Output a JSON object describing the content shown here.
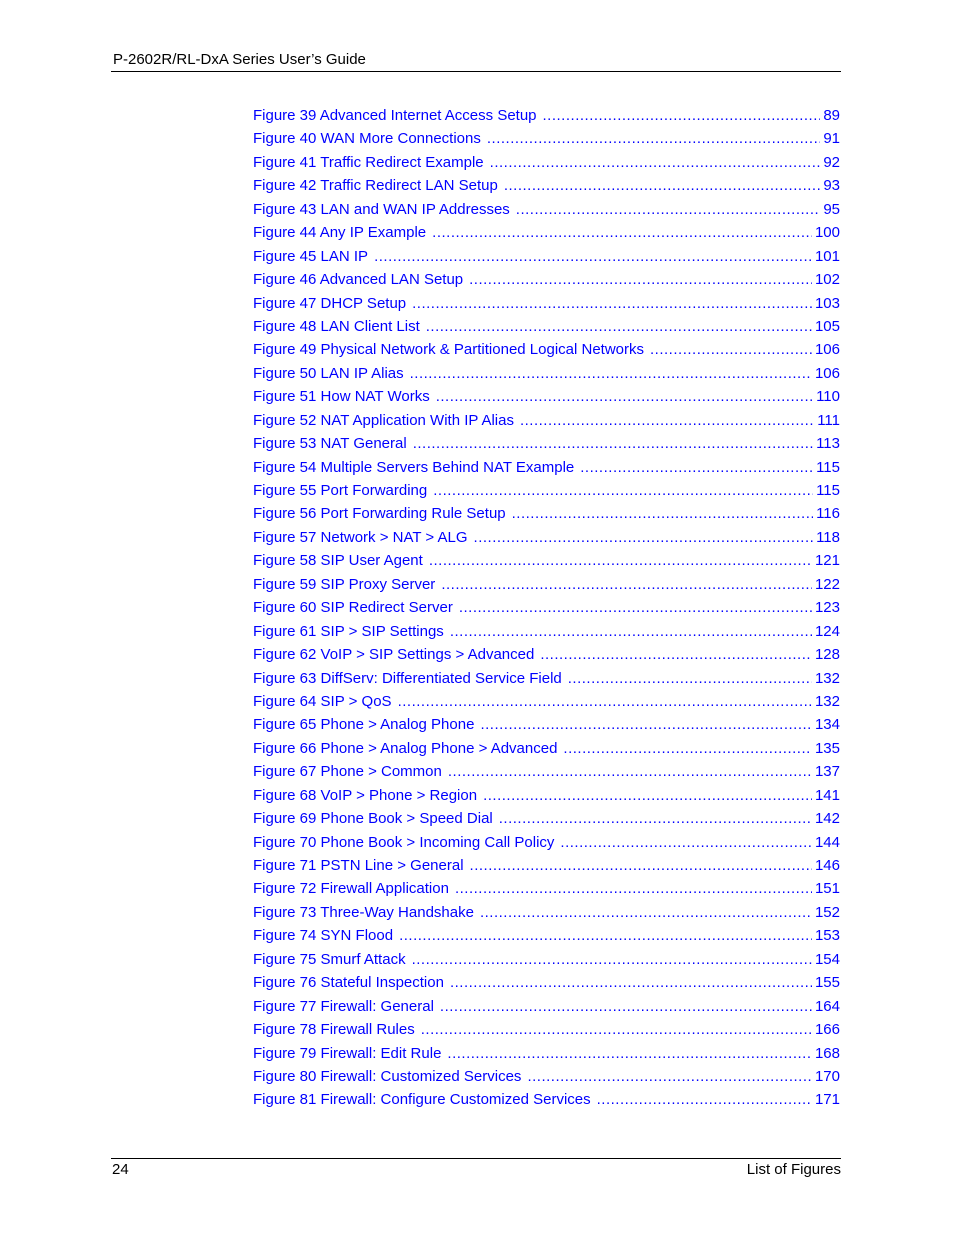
{
  "header": {
    "title": "P-2602R/RL-DxA Series User’s Guide"
  },
  "toc": {
    "entries": [
      {
        "title": "Figure 39 Advanced Internet Access Setup",
        "page": "89"
      },
      {
        "title": "Figure 40 WAN More Connections",
        "page": "91"
      },
      {
        "title": "Figure 41 Traffic Redirect Example",
        "page": "92"
      },
      {
        "title": "Figure 42 Traffic Redirect LAN Setup",
        "page": "93"
      },
      {
        "title": "Figure 43 LAN and WAN IP Addresses",
        "page": "95"
      },
      {
        "title": "Figure 44 Any IP Example",
        "page": "100"
      },
      {
        "title": "Figure 45 LAN IP",
        "page": "101"
      },
      {
        "title": "Figure 46 Advanced LAN Setup",
        "page": "102"
      },
      {
        "title": "Figure 47 DHCP Setup",
        "page": "103"
      },
      {
        "title": "Figure 48 LAN Client List",
        "page": "105"
      },
      {
        "title": "Figure 49 Physical Network & Partitioned Logical Networks",
        "page": "106"
      },
      {
        "title": "Figure 50 LAN IP Alias",
        "page": "106"
      },
      {
        "title": "Figure 51 How NAT Works",
        "page": "110"
      },
      {
        "title": "Figure 52 NAT Application With IP Alias",
        "page": "111"
      },
      {
        "title": "Figure 53 NAT General",
        "page": "113"
      },
      {
        "title": "Figure 54 Multiple Servers Behind NAT Example",
        "page": "115"
      },
      {
        "title": "Figure 55 Port Forwarding",
        "page": "115"
      },
      {
        "title": "Figure 56 Port Forwarding Rule Setup",
        "page": "116"
      },
      {
        "title": "Figure 57 Network > NAT > ALG",
        "page": "118"
      },
      {
        "title": "Figure 58 SIP User Agent",
        "page": "121"
      },
      {
        "title": "Figure 59 SIP Proxy Server",
        "page": "122"
      },
      {
        "title": "Figure 60 SIP Redirect Server",
        "page": "123"
      },
      {
        "title": "Figure 61 SIP > SIP Settings",
        "page": "124"
      },
      {
        "title": "Figure 62 VoIP > SIP Settings > Advanced",
        "page": "128"
      },
      {
        "title": "Figure 63 DiffServ: Differentiated Service Field",
        "page": "132"
      },
      {
        "title": "Figure 64 SIP > QoS",
        "page": "132"
      },
      {
        "title": "Figure 65 Phone > Analog Phone",
        "page": "134"
      },
      {
        "title": "Figure 66 Phone > Analog Phone > Advanced",
        "page": "135"
      },
      {
        "title": "Figure 67 Phone > Common",
        "page": "137"
      },
      {
        "title": "Figure 68 VoIP > Phone > Region",
        "page": "141"
      },
      {
        "title": "Figure 69 Phone Book > Speed Dial",
        "page": "142"
      },
      {
        "title": "Figure 70 Phone Book > Incoming Call Policy",
        "page": "144"
      },
      {
        "title": "Figure 71 PSTN Line > General",
        "page": "146"
      },
      {
        "title": "Figure 72 Firewall Application",
        "page": "151"
      },
      {
        "title": "Figure 73 Three-Way Handshake",
        "page": "152"
      },
      {
        "title": "Figure 74 SYN Flood",
        "page": "153"
      },
      {
        "title": "Figure 75 Smurf Attack",
        "page": "154"
      },
      {
        "title": "Figure 76 Stateful Inspection",
        "page": "155"
      },
      {
        "title": "Figure 77 Firewall: General",
        "page": "164"
      },
      {
        "title": "Figure 78 Firewall Rules",
        "page": "166"
      },
      {
        "title": "Figure 79 Firewall: Edit Rule",
        "page": "168"
      },
      {
        "title": "Figure 80 Firewall: Customized Services",
        "page": "170"
      },
      {
        "title": "Figure 81 Firewall: Configure Customized Services",
        "page": "171"
      }
    ]
  },
  "footer": {
    "page_number": "24",
    "section": "List of Figures"
  },
  "colors": {
    "link": "#0000ff",
    "text": "#000000"
  }
}
